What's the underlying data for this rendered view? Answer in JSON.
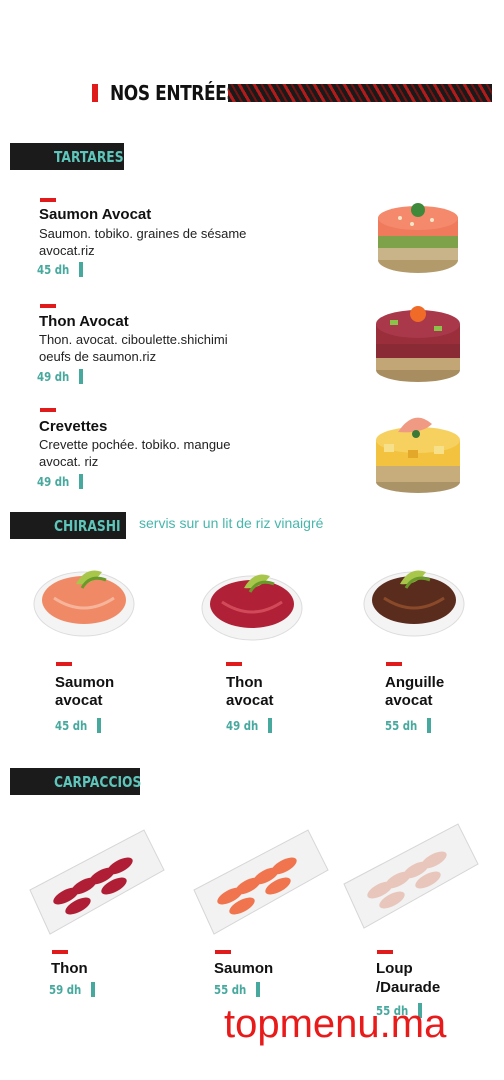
{
  "header": {
    "title": "NOS ENTRÉES"
  },
  "sections": {
    "tartares": {
      "label": "TARTARES",
      "items": [
        {
          "name": "Saumon Avocat",
          "desc1": "Saumon. tobiko. graines de sésame",
          "desc2": "avocat.riz",
          "price": "45 dh"
        },
        {
          "name": "Thon Avocat",
          "desc1": "Thon. avocat. ciboulette.shichimi",
          "desc2": "oeufs de saumon.riz",
          "price": "49 dh"
        },
        {
          "name": "Crevettes",
          "desc1": "Crevette pochée. tobiko. mangue",
          "desc2": "avocat. riz",
          "price": "49 dh"
        }
      ]
    },
    "chirashi": {
      "label": "CHIRASHI",
      "note": "servis sur un lit de riz vinaigré",
      "items": [
        {
          "name1": "Saumon",
          "name2": "avocat",
          "price": "45 dh"
        },
        {
          "name1": "Thon",
          "name2": "avocat",
          "price": "49 dh"
        },
        {
          "name1": "Anguille",
          "name2": "avocat",
          "price": "55 dh"
        }
      ]
    },
    "carpaccios": {
      "label": "CARPACCIOS",
      "items": [
        {
          "name1": "Thon",
          "name2": "",
          "price": "59 dh"
        },
        {
          "name1": "Saumon",
          "name2": "",
          "price": "55 dh"
        },
        {
          "name1": "Loup",
          "name2": "/Daurade",
          "price": "55 dh"
        }
      ]
    }
  },
  "watermark": "topmenu.ma",
  "colors": {
    "accent_red": "#e01b1b",
    "teal": "#47a89e",
    "bar_bg": "#1b1b1b"
  }
}
